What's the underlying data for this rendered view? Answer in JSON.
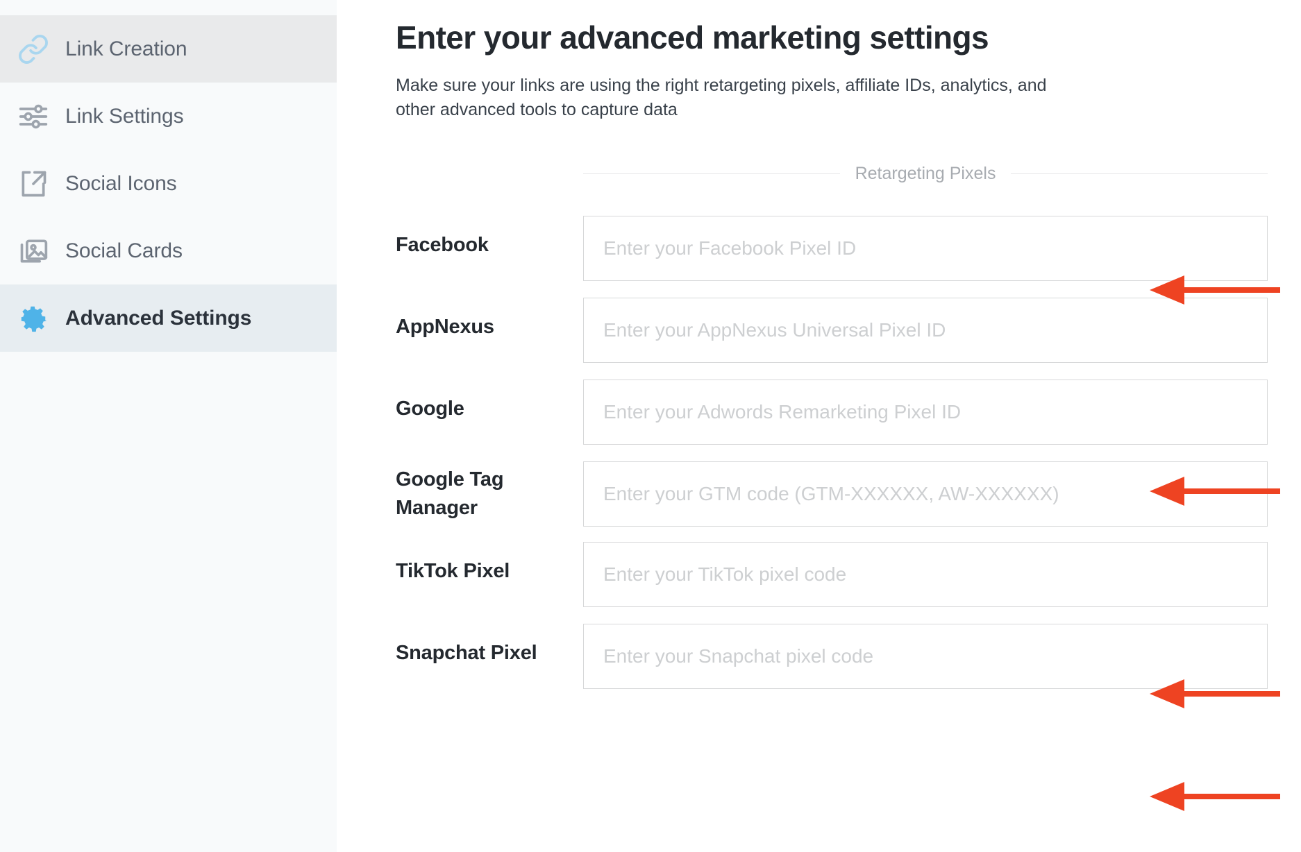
{
  "sidebar": {
    "items": [
      {
        "label": "Link Creation",
        "icon": "link-icon",
        "state": "hovered"
      },
      {
        "label": "Link Settings",
        "icon": "sliders-icon",
        "state": "default"
      },
      {
        "label": "Social Icons",
        "icon": "share-icon",
        "state": "default"
      },
      {
        "label": "Social Cards",
        "icon": "image-stack-icon",
        "state": "default"
      },
      {
        "label": "Advanced Settings",
        "icon": "gear-icon",
        "state": "active"
      }
    ]
  },
  "main": {
    "title": "Enter your advanced marketing settings",
    "subtitle": "Make sure your links are using the right retargeting pixels, affiliate IDs, analytics, and other advanced tools to capture data",
    "section_caption": "Retargeting Pixels",
    "fields": [
      {
        "label": "Facebook",
        "placeholder": "Enter your Facebook Pixel ID",
        "value": "",
        "arrow": true
      },
      {
        "label": "AppNexus",
        "placeholder": "Enter your AppNexus Universal Pixel ID",
        "value": "",
        "arrow": false
      },
      {
        "label": "Google",
        "placeholder": "Enter your Adwords Remarketing Pixel ID",
        "value": "",
        "arrow": true
      },
      {
        "label": "Google Tag Manager",
        "placeholder": "Enter your GTM code (GTM-XXXXXX, AW-XXXXXX)",
        "value": "",
        "arrow": false
      },
      {
        "label": "TikTok Pixel",
        "placeholder": "Enter your TikTok pixel code",
        "value": "",
        "arrow": true
      },
      {
        "label": "Snapchat Pixel",
        "placeholder": "Enter your Snapchat pixel code",
        "value": "",
        "arrow": true
      }
    ]
  },
  "colors": {
    "accent_blue": "#4fb3e8",
    "annotation_red": "#ee4322",
    "sidebar_bg": "#f8fafb",
    "active_item_bg": "#e7edf1",
    "hover_item_bg": "#e9eaeb",
    "title_text": "#24292f",
    "placeholder_text": "#cdcfd1",
    "field_border": "#d7d8d9"
  },
  "annotations": {
    "arrow_count": 4,
    "arrow_direction": "left",
    "arrow_color": "#ee4322"
  }
}
